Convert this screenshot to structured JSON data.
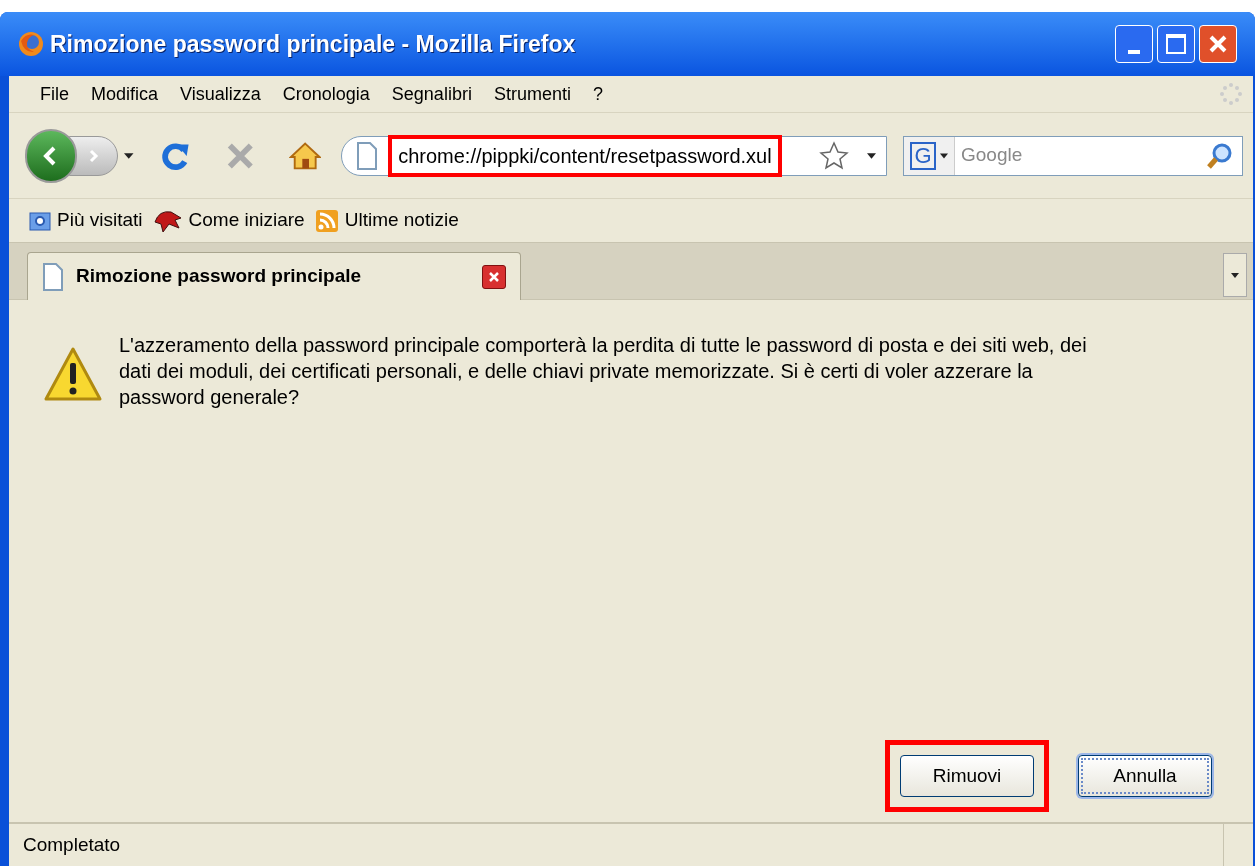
{
  "window": {
    "title": "Rimozione password principale - Mozilla Firefox"
  },
  "menu": [
    {
      "label": "File"
    },
    {
      "label": "Modifica"
    },
    {
      "label": "Visualizza"
    },
    {
      "label": "Cronologia"
    },
    {
      "label": "Segnalibri"
    },
    {
      "label": "Strumenti"
    },
    {
      "label": "?"
    }
  ],
  "navigation": {
    "url": "chrome://pippki/content/resetpassword.xul",
    "url_highlighted": true,
    "search_engine_label": "G",
    "search_placeholder": "Google"
  },
  "bookmarks": [
    {
      "label": "Più visitati",
      "kind": "query"
    },
    {
      "label": "Come iniziare",
      "kind": "page"
    },
    {
      "label": "Ultime notizie",
      "kind": "feed"
    }
  ],
  "tabs": [
    {
      "label": "Rimozione password principale",
      "selected": true
    }
  ],
  "dialog": {
    "message": "L'azzeramento della password principale comporterà la perdita di tutte le password di posta e dei siti web, dei dati dei moduli, dei certificati personali, e delle chiavi private memorizzate. Si è certi di voler azzerare la password generale?",
    "buttons": [
      {
        "label": "Rimuovi",
        "highlighted": true,
        "focused": false
      },
      {
        "label": "Annulla",
        "highlighted": false,
        "focused": true
      }
    ]
  },
  "status_bar": {
    "text": "Completato"
  }
}
